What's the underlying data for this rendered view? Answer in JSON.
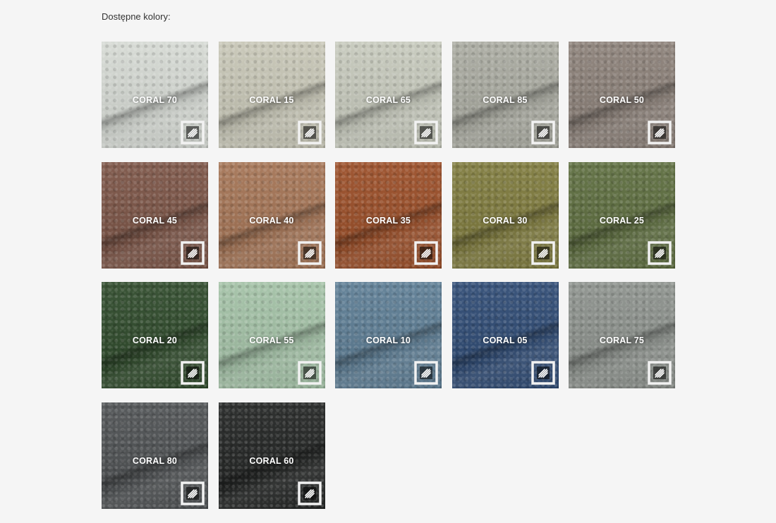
{
  "page": {
    "section_label": "Dostępne kolory:"
  },
  "swatches": [
    {
      "name": "CORAL 70",
      "color": "#d5d9d3",
      "icon": "fabric-texture-icon"
    },
    {
      "name": "CORAL 15",
      "color": "#c7c6b6",
      "icon": "fabric-texture-icon"
    },
    {
      "name": "CORAL 65",
      "color": "#c6c9bc",
      "icon": "fabric-texture-icon"
    },
    {
      "name": "CORAL 85",
      "color": "#a9aaa0",
      "icon": "fabric-texture-icon"
    },
    {
      "name": "CORAL 50",
      "color": "#8b8078",
      "icon": "fabric-texture-icon"
    },
    {
      "name": "CORAL 45",
      "color": "#7b5446",
      "icon": "fabric-texture-icon"
    },
    {
      "name": "CORAL 40",
      "color": "#a47455",
      "icon": "fabric-texture-icon"
    },
    {
      "name": "CORAL 35",
      "color": "#9a4e28",
      "icon": "fabric-texture-icon"
    },
    {
      "name": "CORAL 30",
      "color": "#7e7a3d",
      "icon": "fabric-texture-icon"
    },
    {
      "name": "CORAL 25",
      "color": "#5d6d3f",
      "icon": "fabric-texture-icon"
    },
    {
      "name": "CORAL 20",
      "color": "#2f4a2b",
      "icon": "fabric-texture-icon"
    },
    {
      "name": "CORAL 55",
      "color": "#a3c1a6",
      "icon": "fabric-texture-icon"
    },
    {
      "name": "CORAL 10",
      "color": "#5d7d94",
      "icon": "fabric-texture-icon"
    },
    {
      "name": "CORAL 05",
      "color": "#2f4b74",
      "icon": "fabric-texture-icon"
    },
    {
      "name": "CORAL 75",
      "color": "#8c918c",
      "icon": "fabric-texture-icon"
    },
    {
      "name": "CORAL 80",
      "color": "#4e5153",
      "icon": "fabric-texture-icon"
    },
    {
      "name": "CORAL 60",
      "color": "#232524",
      "icon": "fabric-texture-icon"
    }
  ]
}
